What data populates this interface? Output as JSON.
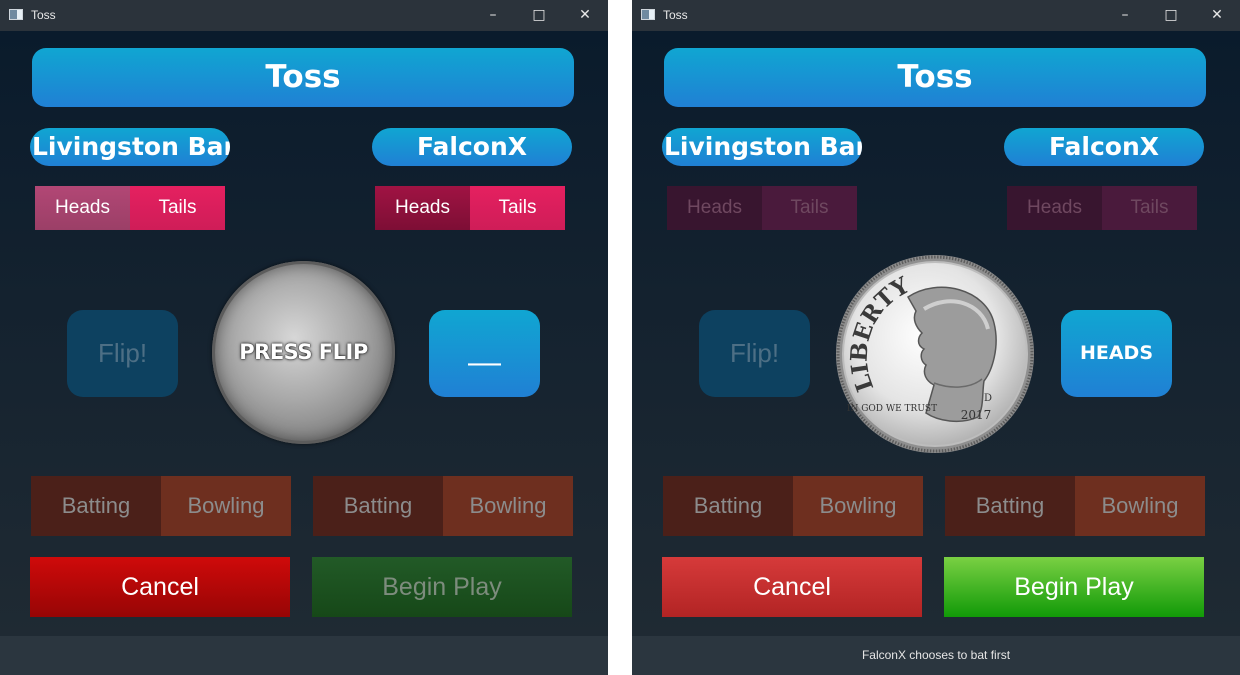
{
  "windows": [
    {
      "title": "Toss",
      "header": "Toss",
      "player_left": "Livingston Bar...",
      "player_right": "FalconX",
      "left_heads": "Heads",
      "left_tails": "Tails",
      "right_heads": "Heads",
      "right_tails": "Tails",
      "flip_label": "Flip!",
      "coin_text": "PRESS FLIP",
      "result": "___",
      "batting": "Batting",
      "bowling": "Bowling",
      "cancel": "Cancel",
      "begin": "Begin Play",
      "status": ""
    },
    {
      "title": "Toss",
      "header": "Toss",
      "player_left": "Livingston Bar...",
      "player_right": "FalconX",
      "left_heads": "Heads",
      "left_tails": "Tails",
      "right_heads": "Heads",
      "right_tails": "Tails",
      "flip_label": "Flip!",
      "coin_liberty": "LIBERTY",
      "coin_motto": "IN GOD WE TRUST",
      "coin_year": "2017",
      "coin_mint": "D",
      "result": "HEADS",
      "batting": "Batting",
      "bowling": "Bowling",
      "cancel": "Cancel",
      "begin": "Begin Play",
      "status": "FalconX chooses to bat first"
    }
  ]
}
